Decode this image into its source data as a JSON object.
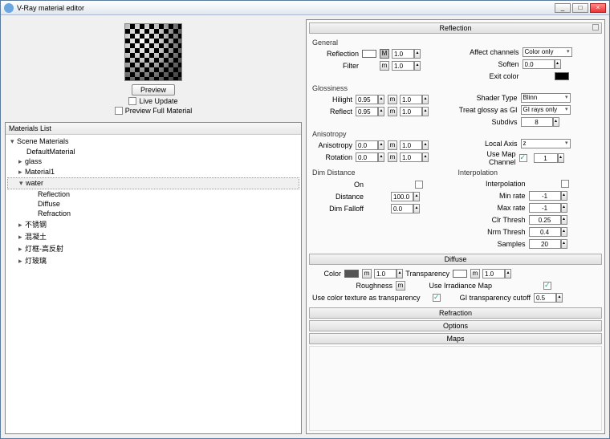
{
  "window": {
    "title": "V-Ray material editor",
    "min": "_",
    "max": "□",
    "close": "×"
  },
  "preview": {
    "btn": "Preview",
    "live": "Live Update",
    "full": "Preview Full Material"
  },
  "matlist": {
    "header": "Materials List",
    "root": "Scene Materials",
    "items": [
      "DefaultMaterial",
      "glass",
      "Material1",
      "water"
    ],
    "water_children": [
      "Reflection",
      "Diffuse",
      "Refraction"
    ],
    "rest": [
      "不锈钢",
      "混凝土",
      "灯框-高反射",
      "灯玻璃"
    ]
  },
  "sections": {
    "reflection": "Reflection",
    "diffuse": "Diffuse",
    "refraction": "Refraction",
    "options": "Options",
    "maps": "Maps"
  },
  "refl": {
    "grp_general": "General",
    "reflection": "Reflection",
    "reflection_m": "M",
    "reflection_v": "1.0",
    "filter": "Filter",
    "filter_m": "m",
    "filter_v": "1.0",
    "affect_ch": "Affect channels",
    "affect_ch_v": "Color only",
    "soften": "Soften",
    "soften_v": "0.0",
    "exit_color": "Exit color",
    "grp_gloss": "Glossiness",
    "hilight": "Hilight",
    "hilight_v": "0.95",
    "hilight_m": "m",
    "hilight_v2": "1.0",
    "reflect": "Reflect",
    "reflect_v": "0.95",
    "reflect_m": "m",
    "reflect_v2": "1.0",
    "shader": "Shader Type",
    "shader_v": "Blinn",
    "treat": "Treat glossy as GI",
    "treat_v": "GI rays only",
    "subdivs": "Subdivs",
    "subdivs_v": "8",
    "grp_aniso": "Anisotropy",
    "aniso": "Anisotropy",
    "aniso_v": "0.0",
    "aniso_m": "m",
    "aniso_v2": "1.0",
    "rot": "Rotation",
    "rot_v": "0.0",
    "rot_m": "m",
    "rot_v2": "1.0",
    "local": "Local Axis",
    "local_v": "z",
    "usemap": "Use Map Channel",
    "usemap_v": "1",
    "grp_dim": "Dim Distance",
    "on": "On",
    "distance": "Distance",
    "distance_v": "100.0",
    "falloff": "Dim Falloff",
    "falloff_v": "0.0",
    "grp_interp": "Interpolation",
    "interp": "Interpolation",
    "minrate": "Min rate",
    "minrate_v": "-1",
    "maxrate": "Max rate",
    "maxrate_v": "-1",
    "clr": "Clr Thresh",
    "clr_v": "0.25",
    "nrm": "Nrm Thresh",
    "nrm_v": "0.4",
    "samples": "Samples",
    "samples_v": "20"
  },
  "diff": {
    "color": "Color",
    "color_m": "m",
    "color_v": "1.0",
    "trans": "Transparency",
    "trans_m": "m",
    "trans_v": "1.0",
    "rough": "Roughness",
    "rough_m": "m",
    "irr": "Use Irradiance Map",
    "usetex": "Use color texture as transparency",
    "gicut": "GI transparency cutoff",
    "gicut_v": "0.5"
  }
}
